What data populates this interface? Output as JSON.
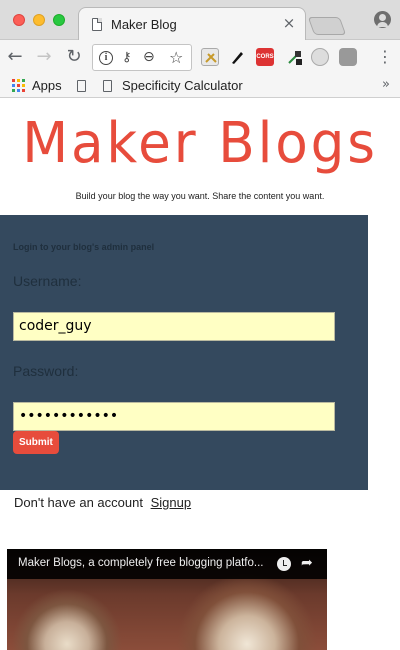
{
  "browser": {
    "tab_title": "Maker Blog",
    "tab_close": "×",
    "nav": {
      "back": "←",
      "forward": "→",
      "reload": "↻",
      "menu": "⋮"
    },
    "omnibox": {
      "info_glyph": "i",
      "key_glyph": "⚷",
      "zoom_glyph": "⊖",
      "star_glyph": "☆"
    },
    "extensions": [
      {
        "icon": "scissors-extension-icon"
      },
      {
        "icon": "pen-extension-icon"
      },
      {
        "icon": "cors-extension-icon",
        "label": "CORS"
      },
      {
        "icon": "eyedropper-extension-icon"
      },
      {
        "icon": "gear-extension-icon"
      },
      {
        "icon": "tools-extension-icon"
      }
    ],
    "bookmarks": {
      "apps_label": "Apps",
      "items": [
        {
          "label": ""
        },
        {
          "label": "Specificity Calculator"
        }
      ],
      "more": "»"
    }
  },
  "page": {
    "logo": "Maker Blogs",
    "tagline": "Build your blog the way you want. Share the content you want.",
    "login": {
      "heading": "Login to your blog's admin panel",
      "username_label": "Username:",
      "username_value": "coder_guy",
      "password_label": "Password:",
      "password_value": "••••••••••••",
      "submit_label": "Submit"
    },
    "signup": {
      "prompt": "Don't have an account",
      "link": "Signup"
    },
    "video": {
      "title": "Maker Blogs, a completely free blogging platfo...",
      "watch_later_icon": "clock-icon",
      "share_icon": "share-arrow-icon"
    }
  },
  "colors": {
    "brand": "#e74c3c",
    "panel": "#34495e",
    "autofill": "#ffffc4"
  }
}
